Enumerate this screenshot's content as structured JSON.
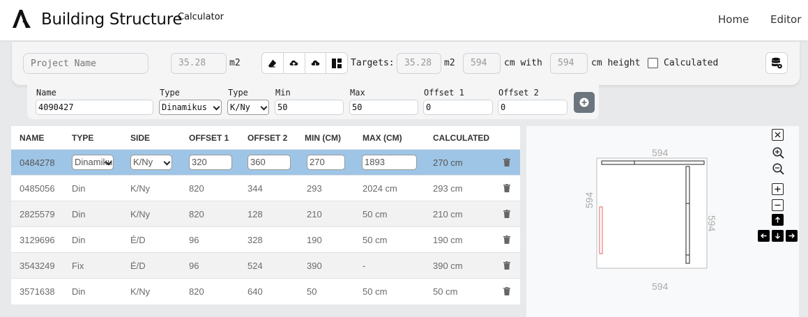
{
  "navbar": {
    "brand": "Building Structure",
    "brand_sub": "Calculator",
    "links": [
      "Home",
      "Editor"
    ]
  },
  "toolbar": {
    "project_name_placeholder": "Project Name",
    "area_value": "35.28",
    "area_unit": "m2",
    "targets_label": "Targets:",
    "target_area": "35.28",
    "target_area_unit": "m2",
    "target_width": "594",
    "cm_with_label": "cm with",
    "target_height": "594",
    "cm_height_label": "cm height",
    "calculated_label": "Calculated",
    "calculated_checked": false,
    "icons": [
      "eraser-icon",
      "cloud-upload-icon",
      "cloud-download-icon",
      "layout-icon",
      "database-settings-icon"
    ]
  },
  "add_form": {
    "labels": [
      "Name",
      "Type",
      "Type",
      "Min",
      "Max",
      "Offset 1",
      "Offset 2"
    ],
    "name_value": "4090427",
    "type_value": "Dinamikus",
    "side_value": "K/Ny",
    "min_value": "50",
    "max_value": "50",
    "offset1_value": "0",
    "offset2_value": "0"
  },
  "table": {
    "headers": [
      "NAME",
      "TYPE",
      "SIDE",
      "OFFSET 1",
      "OFFSET 2",
      "MIN (CM)",
      "MAX (CM)",
      "CALCULATED"
    ],
    "selected_row": {
      "name": "0484278",
      "type": "Dinamikus",
      "side": "K/Ny",
      "offset1": "320",
      "offset2": "360",
      "min": "270",
      "max": "1893",
      "calculated": "270 cm"
    },
    "rows": [
      [
        "0485056",
        "Din",
        "K/Ny",
        "820",
        "344",
        "293",
        "2024 cm",
        "293 cm"
      ],
      [
        "2825579",
        "Din",
        "K/Ny",
        "820",
        "128",
        "210",
        "50 cm",
        "210 cm"
      ],
      [
        "3129696",
        "Din",
        "É/D",
        "96",
        "328",
        "190",
        "50 cm",
        "190 cm"
      ],
      [
        "3543249",
        "Fix",
        "É/D",
        "96",
        "524",
        "390",
        "-",
        "390 cm"
      ],
      [
        "3571638",
        "Din",
        "K/Ny",
        "820",
        "640",
        "50",
        "50 cm",
        "50 cm"
      ]
    ]
  },
  "preview": {
    "dim_top": "594",
    "dim_bottom": "594",
    "dim_left": "594",
    "dim_right": "594",
    "controls": [
      "close-icon",
      "zoom-in-icon",
      "zoom-out-icon",
      "plus-icon",
      "minus-icon",
      "arrow-up-icon",
      "arrow-left-icon",
      "arrow-down-icon",
      "arrow-right-icon"
    ]
  }
}
